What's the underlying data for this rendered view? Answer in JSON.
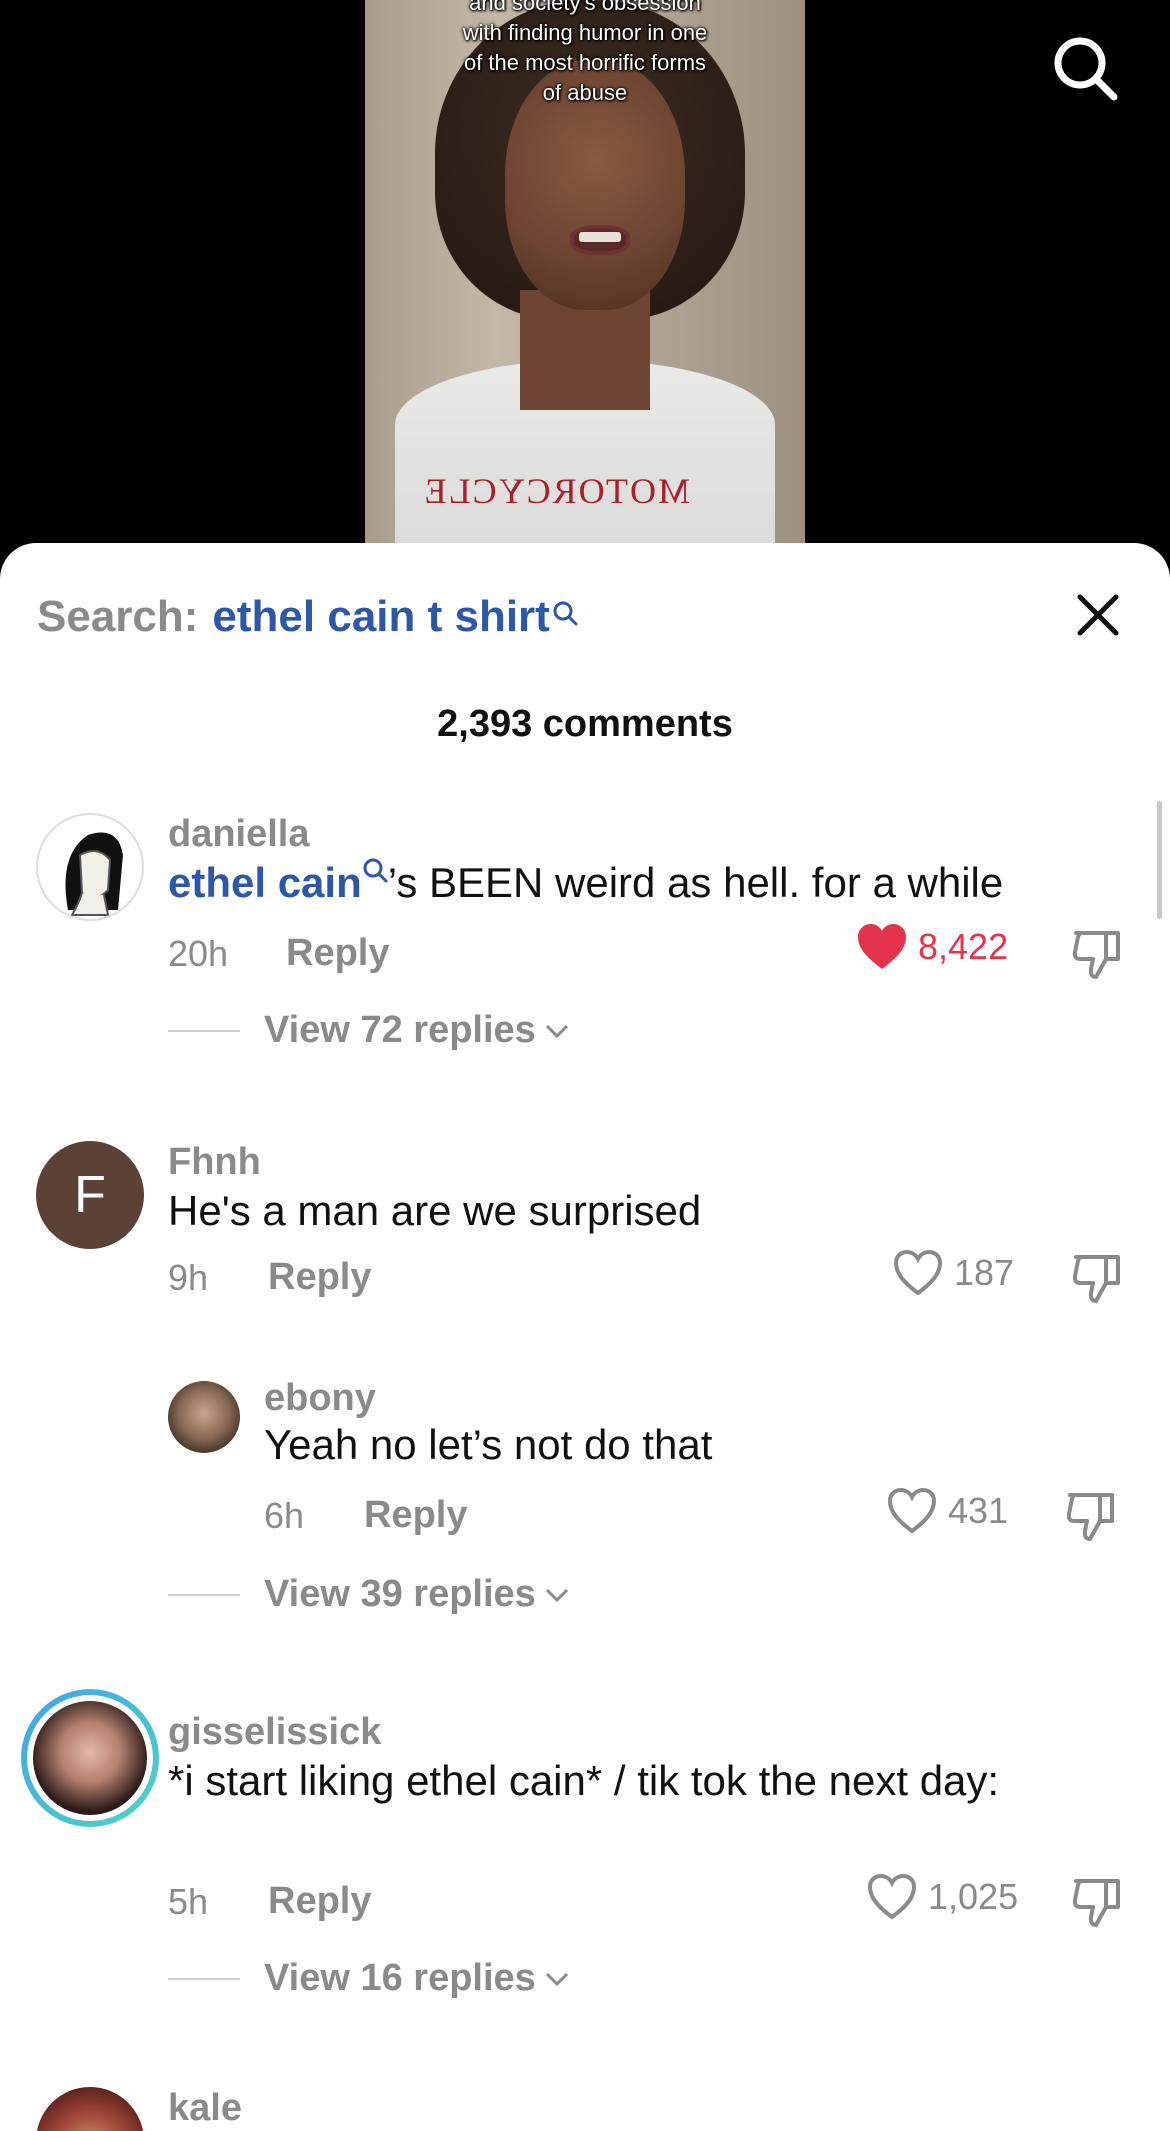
{
  "video": {
    "caption_lines": [
      "and society's obsession",
      "with finding humor in one",
      "of the most horrific forms",
      "of abuse"
    ],
    "shirt_print": "MOTORCYCLE"
  },
  "search_bar": {
    "label": "Search:",
    "term": "ethel cain t shirt"
  },
  "comments_header": {
    "count": "2,393 comments"
  },
  "comments": [
    {
      "username": "daniella",
      "mention": "ethel cain",
      "text": "’s BEEN weird as hell. for a while",
      "time": "20h",
      "reply_label": "Reply",
      "likes": "8,422",
      "liked": true,
      "view_replies": "View 72 replies"
    },
    {
      "username": "Fhnh",
      "avatar_letter": "F",
      "text": "He's a man are we surprised",
      "time": "9h",
      "reply_label": "Reply",
      "likes": "187",
      "liked": false
    },
    {
      "username": "ebony",
      "text": "Yeah no let’s not do that",
      "time": "6h",
      "reply_label": "Reply",
      "likes": "431",
      "liked": false,
      "view_replies": "View 39 replies"
    },
    {
      "username": "gisselissick",
      "text": "*i start liking ethel cain* / tik tok the next day:",
      "time": "5h",
      "reply_label": "Reply",
      "likes": "1,025",
      "liked": false,
      "view_replies": "View 16 replies"
    },
    {
      "username": "kale"
    }
  ],
  "colors": {
    "accent_blue": "#2f57a7",
    "like_red": "#e4344d",
    "muted": "#8a8a8a"
  }
}
